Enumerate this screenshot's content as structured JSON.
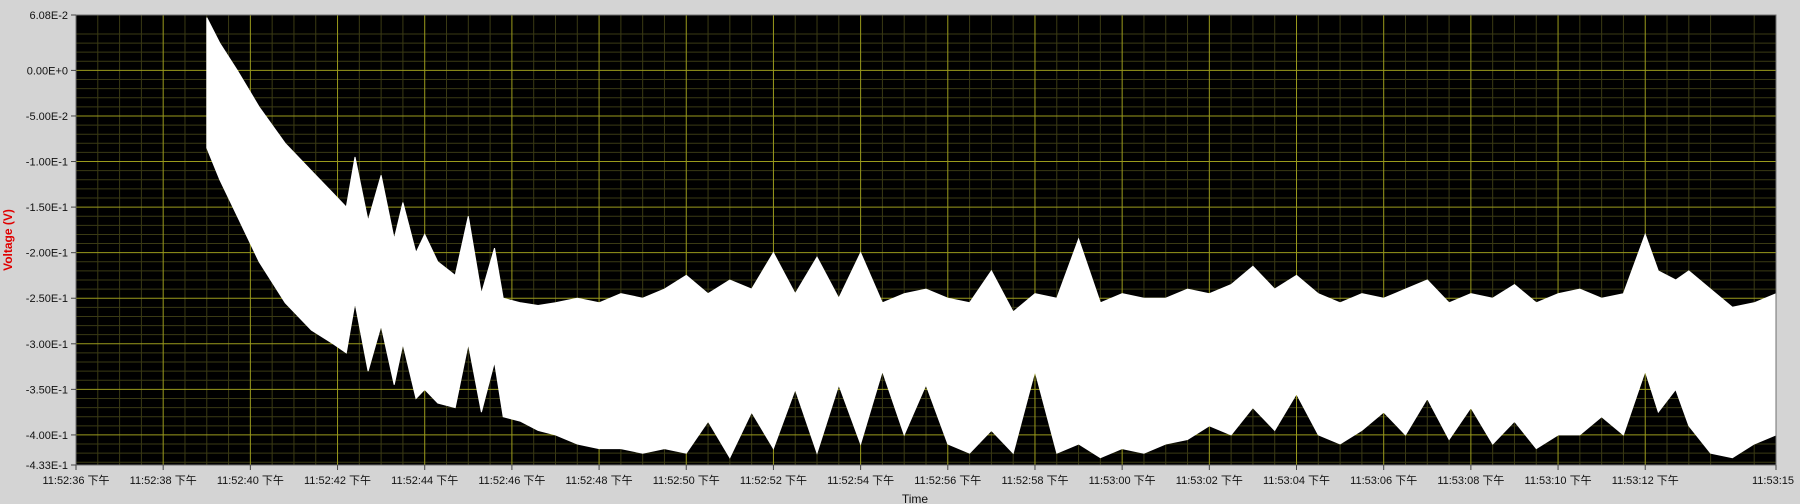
{
  "chart_data": {
    "type": "area",
    "xlabel": "Time",
    "ylabel": "Voltage (V)",
    "ylim": [
      -0.433,
      0.0608
    ],
    "xlim": [
      "11:52:36 下午",
      "11:53:15"
    ],
    "y_tick_labels": [
      "6.08E-2",
      "0.00E+0",
      "-5.00E-2",
      "-1.00E-1",
      "-1.50E-1",
      "-2.00E-1",
      "-2.50E-1",
      "-3.00E-1",
      "-3.50E-1",
      "-4.00E-1",
      "-4.33E-1"
    ],
    "y_tick_values": [
      0.0608,
      0,
      -0.05,
      -0.1,
      -0.15,
      -0.2,
      -0.25,
      -0.3,
      -0.35,
      -0.4,
      -0.433
    ],
    "x_tick_labels": [
      "11:52:36 下午",
      "11:52:38 下午",
      "11:52:40 下午",
      "11:52:42 下午",
      "11:52:44 下午",
      "11:52:46 下午",
      "11:52:48 下午",
      "11:52:50 下午",
      "11:52:52 下午",
      "11:52:54 下午",
      "11:52:56 下午",
      "11:52:58 下午",
      "11:53:00 下午",
      "11:53:02 下午",
      "11:53:04 下午",
      "11:53:06 下午",
      "11:53:08 下午",
      "11:53:10 下午",
      "11:53:12 下午",
      "11:53:15"
    ],
    "x_tick_seconds": [
      0,
      2,
      4,
      6,
      8,
      10,
      12,
      14,
      16,
      18,
      20,
      22,
      24,
      26,
      28,
      30,
      32,
      34,
      36,
      39
    ],
    "grid": true,
    "colors": {
      "plot_background": "#000000",
      "grid_major": "#9a9a1c",
      "grid_minor": "#3a3a14",
      "signal_fill": "#ffffff",
      "ylabel": "#e00000"
    },
    "series": [
      {
        "x_seconds": [
          3.0,
          3.3,
          3.7,
          4.2,
          4.8,
          5.4,
          5.9,
          6.2,
          6.4,
          6.7,
          7.0,
          7.3,
          7.5,
          7.8,
          8.0,
          8.3,
          8.7,
          9.0,
          9.3,
          9.6,
          9.8,
          10.2,
          10.6,
          11.0,
          11.5,
          12.0,
          12.5,
          13.0,
          13.5,
          14.0,
          14.5,
          15.0,
          15.5,
          16.0,
          16.5,
          17.0,
          17.5,
          18.0,
          18.5,
          19.0,
          19.5,
          20.0,
          20.5,
          21.0,
          21.5,
          22.0,
          22.5,
          23.0,
          23.5,
          24.0,
          24.5,
          25.0,
          25.5,
          26.0,
          26.5,
          27.0,
          27.5,
          28.0,
          28.5,
          29.0,
          29.5,
          30.0,
          30.5,
          31.0,
          31.5,
          32.0,
          32.5,
          33.0,
          33.5,
          34.0,
          34.5,
          35.0,
          35.5,
          36.0,
          36.3,
          36.7,
          37.0,
          37.5,
          38.0,
          38.5,
          39.0
        ],
        "upper": [
          0.058,
          0.03,
          0.0,
          -0.04,
          -0.08,
          -0.11,
          -0.135,
          -0.15,
          -0.095,
          -0.165,
          -0.115,
          -0.185,
          -0.145,
          -0.2,
          -0.18,
          -0.21,
          -0.225,
          -0.16,
          -0.245,
          -0.195,
          -0.25,
          -0.255,
          -0.258,
          -0.255,
          -0.25,
          -0.255,
          -0.245,
          -0.25,
          -0.24,
          -0.225,
          -0.245,
          -0.23,
          -0.24,
          -0.2,
          -0.245,
          -0.205,
          -0.25,
          -0.2,
          -0.255,
          -0.245,
          -0.24,
          -0.25,
          -0.255,
          -0.22,
          -0.265,
          -0.245,
          -0.25,
          -0.185,
          -0.255,
          -0.245,
          -0.25,
          -0.25,
          -0.24,
          -0.245,
          -0.235,
          -0.215,
          -0.24,
          -0.225,
          -0.245,
          -0.255,
          -0.245,
          -0.25,
          -0.24,
          -0.23,
          -0.255,
          -0.245,
          -0.25,
          -0.235,
          -0.255,
          -0.245,
          -0.24,
          -0.25,
          -0.245,
          -0.18,
          -0.22,
          -0.23,
          -0.22,
          -0.24,
          -0.26,
          -0.255,
          -0.245
        ],
        "lower": [
          -0.085,
          -0.12,
          -0.16,
          -0.21,
          -0.255,
          -0.285,
          -0.3,
          -0.31,
          -0.255,
          -0.33,
          -0.28,
          -0.345,
          -0.3,
          -0.36,
          -0.35,
          -0.365,
          -0.37,
          -0.3,
          -0.375,
          -0.32,
          -0.38,
          -0.385,
          -0.395,
          -0.4,
          -0.41,
          -0.415,
          -0.415,
          -0.42,
          -0.415,
          -0.42,
          -0.385,
          -0.425,
          -0.375,
          -0.415,
          -0.35,
          -0.42,
          -0.345,
          -0.41,
          -0.33,
          -0.4,
          -0.345,
          -0.41,
          -0.42,
          -0.395,
          -0.42,
          -0.33,
          -0.42,
          -0.41,
          -0.425,
          -0.415,
          -0.42,
          -0.41,
          -0.405,
          -0.39,
          -0.4,
          -0.37,
          -0.395,
          -0.355,
          -0.4,
          -0.41,
          -0.395,
          -0.375,
          -0.4,
          -0.36,
          -0.405,
          -0.37,
          -0.41,
          -0.385,
          -0.415,
          -0.4,
          -0.4,
          -0.38,
          -0.4,
          -0.33,
          -0.375,
          -0.35,
          -0.39,
          -0.42,
          -0.425,
          -0.41,
          -0.4
        ]
      }
    ]
  }
}
